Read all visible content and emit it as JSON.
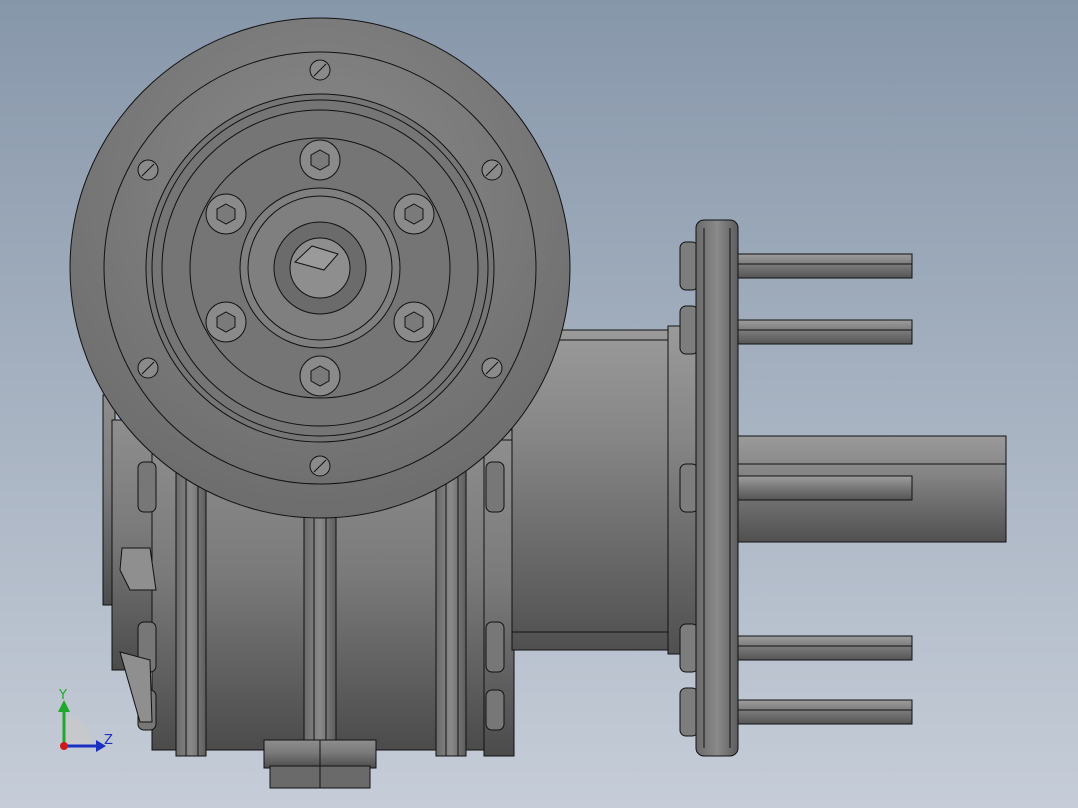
{
  "viewport": {
    "colors": {
      "background_top": "#8797aa",
      "background_bottom": "#c6cdd8",
      "part_light": "#8a8a8a",
      "part_dark": "#4a4a4a",
      "edge": "#111111"
    }
  },
  "triad": {
    "y_label": "Y",
    "z_label": "Z",
    "colors": {
      "y_axis": "#1fa82b",
      "z_axis": "#1b2fc0",
      "x_origin": "#d01818"
    }
  }
}
